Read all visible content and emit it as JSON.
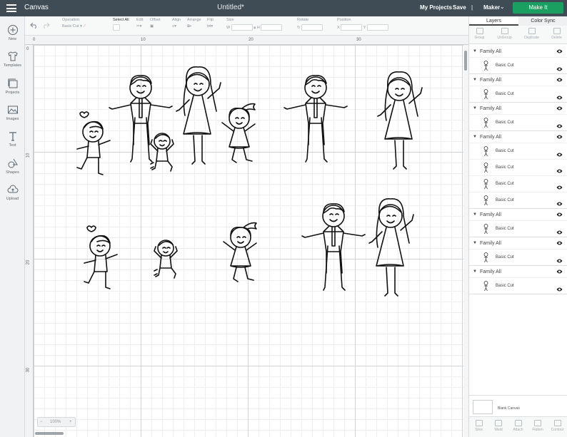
{
  "topbar": {
    "app_title": "Canvas",
    "doc_title": "Untitled*",
    "my_projects": "My Projects",
    "save": "Save",
    "separator": "|",
    "machine": "Maker",
    "make_it": "Make It"
  },
  "toolbar": {
    "operation": {
      "label": "Operation",
      "value": "Basic Cut"
    },
    "select_all": "Select All",
    "edit": "Edit",
    "offset": "Offset",
    "align": "Align",
    "arrange": "Arrange",
    "flip": "Flip",
    "size": {
      "label": "Size",
      "w": "W",
      "h": "H"
    },
    "rotate": "Rotate",
    "position": {
      "label": "Position",
      "x": "X",
      "y": "Y"
    }
  },
  "leftnav": [
    {
      "label": "New",
      "icon": "plus-icon"
    },
    {
      "label": "Templates",
      "icon": "tshirt-icon"
    },
    {
      "label": "Projects",
      "icon": "projects-icon"
    },
    {
      "label": "Images",
      "icon": "image-icon"
    },
    {
      "label": "Text",
      "icon": "text-icon"
    },
    {
      "label": "Shapes",
      "icon": "shapes-icon"
    },
    {
      "label": "Upload",
      "icon": "cloud-upload-icon"
    }
  ],
  "ruler": {
    "top": [
      "0",
      "10",
      "20",
      "30"
    ],
    "left": [
      "0",
      "10",
      "20",
      "30"
    ]
  },
  "zoom": {
    "minus": "−",
    "value": "100%",
    "plus": "+"
  },
  "panel": {
    "tabs": [
      "Layers",
      "Color Sync"
    ],
    "tools": [
      "Group",
      "UnGroup",
      "Duplicate",
      "Delete"
    ],
    "groups": [
      {
        "name": "Family All",
        "items": [
          {
            "label": "Basic Cut"
          }
        ]
      },
      {
        "name": "Family All",
        "items": [
          {
            "label": "Basic Cut"
          }
        ]
      },
      {
        "name": "Family All",
        "items": [
          {
            "label": "Basic Cut"
          }
        ]
      },
      {
        "name": "Family All",
        "items": [
          {
            "label": "Basic Cut"
          },
          {
            "label": "Basic Cut"
          },
          {
            "label": "Basic Cut"
          },
          {
            "label": "Basic Cut"
          }
        ]
      },
      {
        "name": "Family All",
        "items": [
          {
            "label": "Basic Cut"
          }
        ]
      },
      {
        "name": "Family All",
        "items": [
          {
            "label": "Basic Cut"
          }
        ]
      },
      {
        "name": "Family All",
        "items": [
          {
            "label": "Basic Cut"
          }
        ]
      }
    ],
    "blank_canvas": "Blank Canvas",
    "bottom_tools": [
      "Slice",
      "Weld",
      "Attach",
      "Flatten",
      "Contour"
    ]
  }
}
